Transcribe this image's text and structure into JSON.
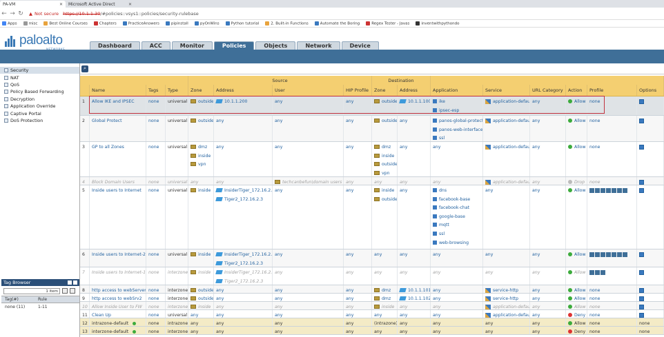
{
  "browser": {
    "tabs": [
      {
        "label": "PA-VM",
        "active": true
      },
      {
        "label": "Microsoft Active Direct",
        "active": false
      }
    ],
    "not_secure": "Not secure",
    "url_host": "https://10.1.1.30",
    "url_path": "/#policies::vsys1::policies/security-rulebase",
    "bookmarks": [
      "Apps",
      "misc",
      "Best Online Courses",
      "Chapters",
      "PracticeAnswers",
      "pipinstall",
      "pyOnWins",
      "Python tutorial",
      "2. Built-in Functions",
      "Automate the Boring",
      "Regex Tester - Javas",
      "inventwithpythondo"
    ]
  },
  "app": {
    "logo_text": "paloalto",
    "logo_sub": "NETWORKS",
    "nav_tabs": [
      "Dashboard",
      "ACC",
      "Monitor",
      "Policies",
      "Objects",
      "Network",
      "Device"
    ],
    "active_tab": "Policies"
  },
  "sidebar": {
    "items": [
      "Security",
      "NAT",
      "QoS",
      "Policy Based Forwarding",
      "Decryption",
      "Application Override",
      "Captive Portal",
      "DoS Protection"
    ],
    "selected": "Security"
  },
  "tag_browser": {
    "title": "Tag Browser",
    "count": "1 item",
    "col_tag": "Tag(#)",
    "col_rule": "Rule",
    "rows": [
      {
        "tag": "none (11)",
        "rule": "1-11"
      }
    ]
  },
  "table": {
    "group_source": "Source",
    "group_destination": "Destination",
    "headers": [
      "",
      "Name",
      "Tags",
      "Type",
      "Zone",
      "Address",
      "User",
      "HIP Profile",
      "Zone",
      "Address",
      "Application",
      "Service",
      "URL Category",
      "Action",
      "Profile",
      "Options"
    ],
    "rows": [
      {
        "num": "1",
        "name": "Allow IKE and IPSEC",
        "tags": "none",
        "type": "universal",
        "szone": [
          "outside"
        ],
        "saddr": [
          "10.1.1.200"
        ],
        "user": [
          "any"
        ],
        "hip": "any",
        "dzone": [
          "outside"
        ],
        "daddr": [
          "10.1.1.100"
        ],
        "app": [
          "ike",
          "ipsec-esp"
        ],
        "svc": [
          "application-default"
        ],
        "url": "any",
        "action": "Allow",
        "profile": "none"
      },
      {
        "num": "2",
        "name": "Global Protect",
        "tags": "none",
        "type": "universal",
        "szone": [
          "outside"
        ],
        "saddr": [
          "any"
        ],
        "user": [
          "any"
        ],
        "hip": "any",
        "dzone": [
          "outside"
        ],
        "daddr": [
          "any"
        ],
        "app": [
          "panos-global-protect",
          "panos-web-interface",
          "ssl"
        ],
        "svc": [
          "application-default"
        ],
        "url": "any",
        "action": "Allow",
        "profile": "none"
      },
      {
        "num": "3",
        "name": "GP to all Zones",
        "tags": "none",
        "type": "universal",
        "szone": [
          "dmz",
          "inside",
          "vpn"
        ],
        "saddr": [
          "any"
        ],
        "user": [
          "any"
        ],
        "hip": "any",
        "dzone": [
          "dmz",
          "inside",
          "outside",
          "vpn"
        ],
        "daddr": [
          "any"
        ],
        "app": [
          "any"
        ],
        "svc": [
          "application-default"
        ],
        "url": "any",
        "action": "Allow",
        "profile": "none"
      },
      {
        "num": "4",
        "name": "Block Domain Users",
        "tags": "none",
        "type": "universal",
        "szone": [
          "any"
        ],
        "saddr": [
          "any"
        ],
        "user": [
          "techcanbefun\\domain users"
        ],
        "hip": "any",
        "dzone": [
          "any"
        ],
        "daddr": [
          "any"
        ],
        "app": [
          "any"
        ],
        "svc": [
          "application-default"
        ],
        "url": "any",
        "action": "Drop",
        "profile": "none"
      },
      {
        "num": "5",
        "name": "Inside users to Internet",
        "tags": "none",
        "type": "universal",
        "szone": [
          "inside"
        ],
        "saddr": [
          "InsiderTiger_172.16.2.2",
          "Tiger2_172.16.2.3"
        ],
        "user": [
          "any"
        ],
        "hip": "any",
        "dzone": [
          "inside",
          "outside"
        ],
        "daddr": [
          "any"
        ],
        "app": [
          "dns",
          "facebook-base",
          "facebook-chat",
          "google-base",
          "mqtt",
          "ssl",
          "web-browsing"
        ],
        "svc": [
          "any"
        ],
        "url": "any",
        "action": "Allow",
        "profile": ""
      },
      {
        "num": "6",
        "name": "Inside users to Internet-2",
        "tags": "none",
        "type": "universal",
        "szone": [
          "inside"
        ],
        "saddr": [
          "InsiderTiger_172.16.2.2",
          "Tiger2_172.16.2.3"
        ],
        "user": [
          "any"
        ],
        "hip": "any",
        "dzone": [
          "any"
        ],
        "daddr": [
          "any"
        ],
        "app": [
          "any"
        ],
        "svc": [
          "any"
        ],
        "url": "any",
        "action": "Allow",
        "profile": ""
      },
      {
        "num": "7",
        "name": "Inside users to Internet-1",
        "tags": "none",
        "type": "interzone",
        "szone": [
          "inside"
        ],
        "saddr": [
          "InsiderTiger_172.16.2.2",
          "Tiger2_172.16.2.3"
        ],
        "user": [
          "any"
        ],
        "hip": "any",
        "dzone": [
          "any"
        ],
        "daddr": [
          "any"
        ],
        "app": [
          "any"
        ],
        "svc": [
          "any"
        ],
        "url": "any",
        "action": "Allow",
        "profile": ""
      },
      {
        "num": "8",
        "name": "http access to webServer",
        "tags": "none",
        "type": "interzone",
        "szone": [
          "outside"
        ],
        "saddr": [
          "any"
        ],
        "user": [
          "any"
        ],
        "hip": "any",
        "dzone": [
          "dmz"
        ],
        "daddr": [
          "10.1.1.101"
        ],
        "app": [
          "any"
        ],
        "svc": [
          "service-http"
        ],
        "url": "any",
        "action": "Allow",
        "profile": "none"
      },
      {
        "num": "9",
        "name": "http access to webSrv2",
        "tags": "none",
        "type": "interzone",
        "szone": [
          "outside"
        ],
        "saddr": [
          "any"
        ],
        "user": [
          "any"
        ],
        "hip": "any",
        "dzone": [
          "dmz"
        ],
        "daddr": [
          "10.1.1.102"
        ],
        "app": [
          "any"
        ],
        "svc": [
          "service-http"
        ],
        "url": "any",
        "action": "Allow",
        "profile": "none"
      },
      {
        "num": "10",
        "name": "Allow Inside User to FW",
        "tags": "none",
        "type": "interzone",
        "szone": [
          "inside"
        ],
        "saddr": [
          "any"
        ],
        "user": [
          "any"
        ],
        "hip": "any",
        "dzone": [
          "inside"
        ],
        "daddr": [
          "any"
        ],
        "app": [
          "any"
        ],
        "svc": [
          "application-default"
        ],
        "url": "any",
        "action": "Allow",
        "profile": "none"
      },
      {
        "num": "11",
        "name": "Clean Up",
        "tags": "none",
        "type": "universal",
        "szone": [
          "any"
        ],
        "saddr": [
          "any"
        ],
        "user": [
          "any"
        ],
        "hip": "any",
        "dzone": [
          "any"
        ],
        "daddr": [
          "any"
        ],
        "app": [
          "any"
        ],
        "svc": [
          "application-default"
        ],
        "url": "any",
        "action": "Deny",
        "profile": "none"
      },
      {
        "num": "12",
        "name": "intrazone-default",
        "tags": "none",
        "type": "intrazone",
        "szone": [
          "any"
        ],
        "saddr": [
          "any"
        ],
        "user": [
          "any"
        ],
        "hip": "any",
        "dzone": [
          "(intrazone)"
        ],
        "daddr": [
          "any"
        ],
        "app": [
          "any"
        ],
        "svc": [
          "any"
        ],
        "url": "any",
        "action": "Allow",
        "profile": "none",
        "options": "none"
      },
      {
        "num": "13",
        "name": "interzone-default",
        "tags": "none",
        "type": "interzone",
        "szone": [
          "any"
        ],
        "saddr": [
          "any"
        ],
        "user": [
          "any"
        ],
        "hip": "any",
        "dzone": [
          "any"
        ],
        "daddr": [
          "any"
        ],
        "app": [
          "any"
        ],
        "svc": [
          "any"
        ],
        "url": "any",
        "action": "Deny",
        "profile": "none",
        "options": "none"
      }
    ]
  }
}
